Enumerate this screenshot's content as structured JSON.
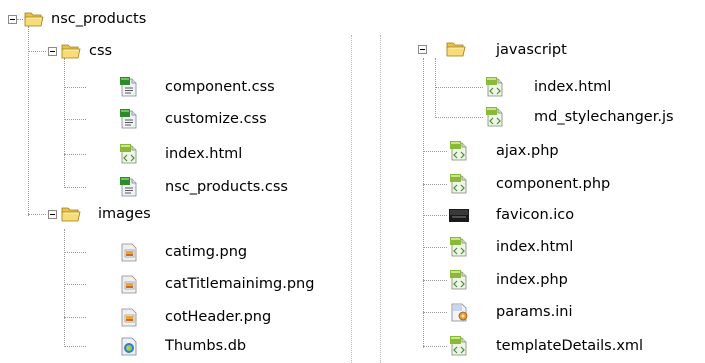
{
  "left": {
    "root": {
      "label": "nsc_products",
      "icon": "folder-open-icon"
    },
    "css": {
      "label": "css",
      "icon": "folder-open-icon",
      "children": [
        {
          "label": "component.css",
          "icon": "css-file-icon"
        },
        {
          "label": "customize.css",
          "icon": "css-file-icon"
        },
        {
          "label": "index.html",
          "icon": "html-file-icon"
        },
        {
          "label": "nsc_products.css",
          "icon": "css-file-icon"
        }
      ]
    },
    "images": {
      "label": "images",
      "icon": "folder-open-icon",
      "children": [
        {
          "label": "catimg.png",
          "icon": "image-file-icon"
        },
        {
          "label": "catTitlemainimg.png",
          "icon": "image-file-icon"
        },
        {
          "label": "cotHeader.png",
          "icon": "image-file-icon"
        },
        {
          "label": "Thumbs.db",
          "icon": "db-file-icon"
        }
      ]
    }
  },
  "right": {
    "javascript": {
      "label": "javascript",
      "icon": "folder-open-icon",
      "children": [
        {
          "label": "index.html",
          "icon": "html-file-icon"
        },
        {
          "label": "md_stylechanger.js",
          "icon": "html-file-icon"
        }
      ]
    },
    "files": [
      {
        "label": "ajax.php",
        "icon": "html-file-icon"
      },
      {
        "label": "component.php",
        "icon": "html-file-icon"
      },
      {
        "label": "favicon.ico",
        "icon": "ico-file-icon"
      },
      {
        "label": "index.html",
        "icon": "html-file-icon"
      },
      {
        "label": "index.php",
        "icon": "html-file-icon"
      },
      {
        "label": "params.ini",
        "icon": "ini-file-icon"
      },
      {
        "label": "templateDetails.xml",
        "icon": "html-file-icon"
      }
    ]
  }
}
